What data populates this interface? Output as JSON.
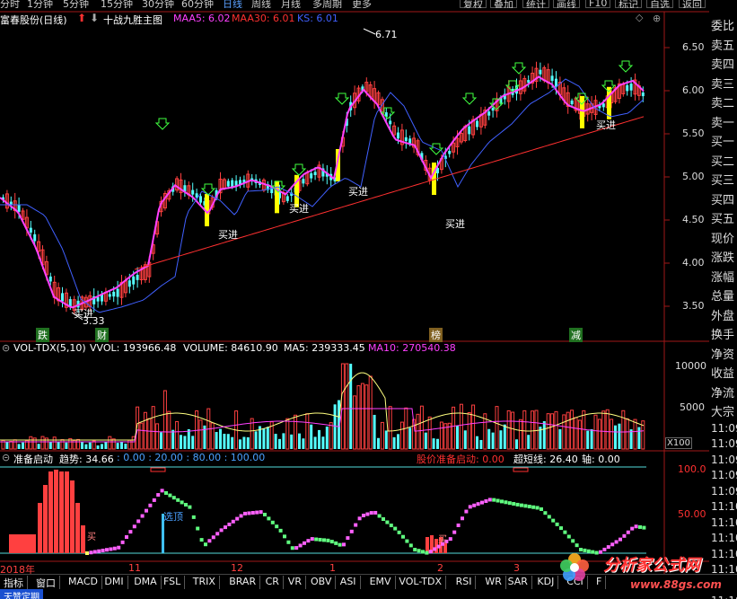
{
  "toolbar": {
    "timeframes": [
      "分时",
      "1分钟",
      "5分钟",
      "15分钟",
      "30分钟",
      "60分钟",
      "日线",
      "周线",
      "月线",
      "多周期",
      "更多"
    ],
    "buttons": [
      "复权",
      "叠加",
      "统计",
      "画线",
      "F10",
      "标记",
      "自选",
      "返回"
    ]
  },
  "main": {
    "stock_label": "富春股份(日线)",
    "formula_label": "十战九胜主图",
    "ma5_label": "MAA5: 6.02",
    "ma30_label": "MAA30: 6.01",
    "ks_label": "KS: 6.01",
    "high_label": "6.71",
    "low_label": "3.33",
    "buy_label": "买进",
    "event_labels": [
      "跌",
      "财",
      "榜",
      "减"
    ],
    "price_ticks": [
      "6.50",
      "6.00",
      "5.50",
      "5.00",
      "4.50",
      "4.00",
      "3.50"
    ]
  },
  "volume": {
    "title": "VOL-TDX(5,10)",
    "vvol_label": "VVOL: 193966.48",
    "volume_label": "VOLUME: 84610.90",
    "ma5_label": "MA5: 239333.45",
    "ma10_label": "MA10: 270540.38",
    "ticks": [
      "10000",
      "5000"
    ],
    "unit": "X100"
  },
  "indicator": {
    "title": "准备启动",
    "trend_label": "趋势: 34.66",
    "levels_label": ": 0.00 : 20.00 : 80.00 : 100.00",
    "ready_label": "股价准备启动: 0.00",
    "oversold_label": "超短线: 26.40",
    "axis_label": "轴: 0.00",
    "ticks": [
      "100.0",
      "50.00"
    ],
    "selectbuy_label": "选顶",
    "buy_label": "买"
  },
  "date_axis": {
    "labels": [
      "2018年",
      "11",
      "12",
      "1",
      "2",
      "3"
    ]
  },
  "rightpanel": {
    "items": [
      "委比",
      "卖五",
      "卖四",
      "卖三",
      "卖二",
      "卖一",
      "买一",
      "买二",
      "买三",
      "买四",
      "买五",
      "现价",
      "涨跌",
      "涨幅",
      "总量",
      "外盘",
      "换手",
      "净资",
      "收益",
      "净流",
      "大宗",
      "11:09",
      "11:09",
      "11:09",
      "11:09",
      "11:09",
      "11:10",
      "11:10",
      "11:10",
      "11:10",
      "11:10",
      "11:10",
      "11:10"
    ]
  },
  "tabs": [
    "指标",
    "窗口",
    "MACD",
    "DMI",
    "DMA",
    "FSL",
    "TRIX",
    "BRAR",
    "CR",
    "VR",
    "OBV",
    "ASI",
    "EMV",
    "VOL-TDX",
    "RSI",
    "WR",
    "SAR",
    "KDJ",
    "CCI",
    "F"
  ],
  "bottom": {
    "left_label": "天赞定期",
    "brand": "分析家公式网",
    "url": "www.88gs.com"
  },
  "colors": {
    "up": "#ff4040",
    "down": "#54ffff",
    "ma5": "#ff40ff",
    "ma30": "#ff3030",
    "ks": "#4060ff",
    "buy_bar": "#ffff00",
    "axis": "#c02020"
  }
}
